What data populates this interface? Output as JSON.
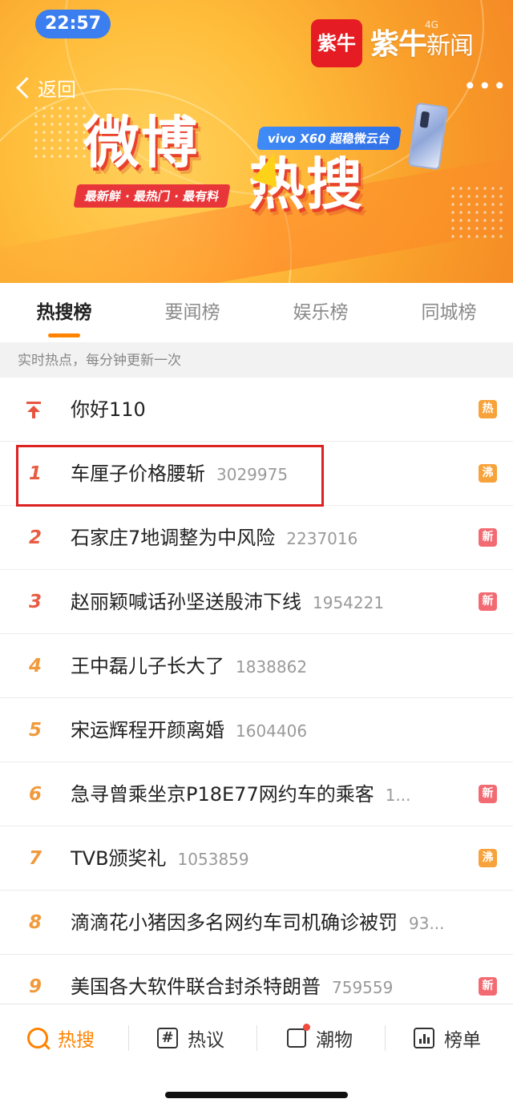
{
  "status": {
    "time": "22:57"
  },
  "banner": {
    "logo_mark": "紫牛",
    "logo_name": "紫牛",
    "logo_sub": "新闻",
    "tiny": "4G",
    "back_label": "返回",
    "more": "•••",
    "title_part1": "微博",
    "title_part2": "热搜",
    "tagline": "最新鲜 · 最热门 · 最有料",
    "ad_label": "vivo X60 超稳微云台"
  },
  "tabs": [
    {
      "label": "热搜榜",
      "active": true
    },
    {
      "label": "要闻榜"
    },
    {
      "label": "娱乐榜"
    },
    {
      "label": "同城榜"
    }
  ],
  "notice": "实时热点，每分钟更新一次",
  "list": [
    {
      "rank": "",
      "title": "你好110",
      "count": "",
      "badge": "热",
      "badge_type": "hot"
    },
    {
      "rank": "1",
      "title": "车厘子价格腰斩",
      "count": "3029975",
      "badge": "沸",
      "badge_type": "boil"
    },
    {
      "rank": "2",
      "title": "石家庄7地调整为中风险",
      "count": "2237016",
      "badge": "新",
      "badge_type": "new"
    },
    {
      "rank": "3",
      "title": "赵丽颖喊话孙坚送殷沛下线",
      "count": "1954221",
      "badge": "新",
      "badge_type": "new"
    },
    {
      "rank": "4",
      "title": "王中磊儿子长大了",
      "count": "1838862",
      "badge": "",
      "badge_type": ""
    },
    {
      "rank": "5",
      "title": "宋运辉程开颜离婚",
      "count": "1604406",
      "badge": "",
      "badge_type": ""
    },
    {
      "rank": "6",
      "title": "急寻曾乘坐京P18E77网约车的乘客",
      "count": "1...",
      "badge": "新",
      "badge_type": "new"
    },
    {
      "rank": "7",
      "title": "TVB颁奖礼",
      "count": "1053859",
      "badge": "沸",
      "badge_type": "boil"
    },
    {
      "rank": "8",
      "title": "滴滴花小猪因多名网约车司机确诊被罚",
      "count": "93...",
      "badge": "",
      "badge_type": ""
    },
    {
      "rank": "9",
      "title": "美国各大软件联合封杀特朗普",
      "count": "759559",
      "badge": "新",
      "badge_type": "new"
    }
  ],
  "bottom_nav": [
    {
      "label": "热搜",
      "icon": "search-icon",
      "active": true
    },
    {
      "label": "热议",
      "icon": "hashtag-icon"
    },
    {
      "label": "潮物",
      "icon": "gift-icon"
    },
    {
      "label": "榜单",
      "icon": "chart-icon"
    }
  ],
  "colors": {
    "accent": "#ff8200",
    "hot": "#f7a23a",
    "new": "#f26b73",
    "rank_top": "#e85c43",
    "rank_mid": "#f09a3c"
  }
}
